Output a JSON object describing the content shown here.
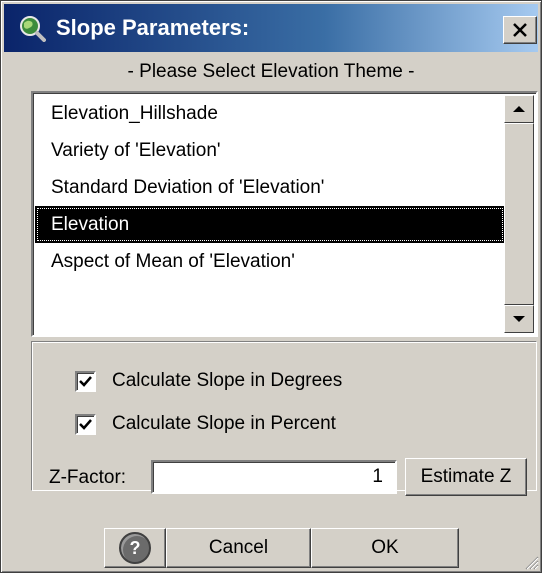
{
  "window": {
    "title": "Slope Parameters:",
    "close_label": "close"
  },
  "prompt": "- Please Select Elevation Theme -",
  "themes": [
    {
      "label": "Elevation_Hillshade",
      "selected": false
    },
    {
      "label": "Variety of 'Elevation'",
      "selected": false
    },
    {
      "label": "Standard Deviation of 'Elevation'",
      "selected": false
    },
    {
      "label": "Elevation",
      "selected": true
    },
    {
      "label": "Aspect of Mean of 'Elevation'",
      "selected": false
    }
  ],
  "options": {
    "degrees": {
      "label": "Calculate Slope in Degrees",
      "checked": true
    },
    "percent": {
      "label": "Calculate Slope in Percent",
      "checked": true
    }
  },
  "zfactor": {
    "label": "Z-Factor:",
    "value": "1",
    "estimate_label": "Estimate Z"
  },
  "buttons": {
    "help": "?",
    "cancel": "Cancel",
    "ok": "OK"
  },
  "colors": {
    "titlebar": "#0a246a",
    "face": "#d4d0c8",
    "selection": "#000000"
  }
}
